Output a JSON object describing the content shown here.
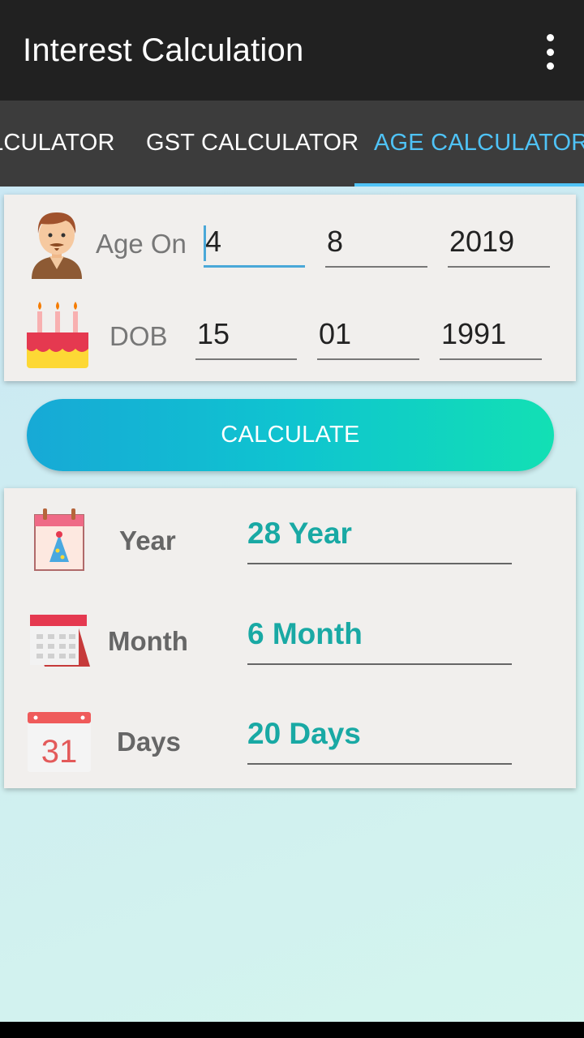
{
  "appbar": {
    "title": "Interest Calculation",
    "menu_icon": "more-vert-icon"
  },
  "tabs": [
    {
      "label": "LCULATOR",
      "selected": false
    },
    {
      "label": "GST CALCULATOR",
      "selected": false
    },
    {
      "label": "AGE CALCULATOR",
      "selected": true
    }
  ],
  "colors": {
    "accent": "#4fc3f7",
    "result_text": "#19a9a4",
    "appbar": "#212121",
    "tabbar": "#3c3c3c"
  },
  "age_on": {
    "label": "Age On",
    "icon": "man-avatar-icon",
    "day": "4",
    "month": "8",
    "year": "2019"
  },
  "dob": {
    "label": "DOB",
    "icon": "birthday-cake-icon",
    "day": "15",
    "month": "01",
    "year": "1991"
  },
  "calculate_label": "CALCULATE",
  "results": {
    "year": {
      "label": "Year",
      "value": "28 Year",
      "icon": "party-calendar-icon"
    },
    "month": {
      "label": "Month",
      "value": "6 Month",
      "icon": "desk-calendar-icon"
    },
    "days": {
      "label": "Days",
      "value": "20 Days",
      "icon": "calendar-31-icon",
      "icon_text": "31"
    }
  }
}
